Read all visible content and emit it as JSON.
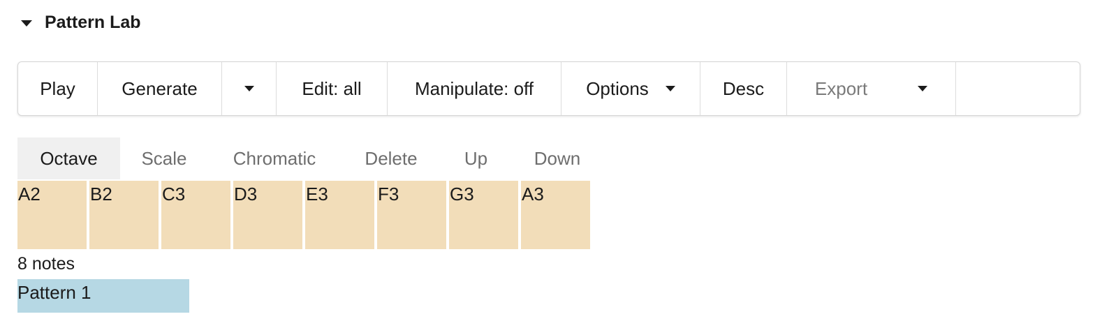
{
  "section": {
    "title": "Pattern Lab"
  },
  "toolbar": {
    "play": "Play",
    "generate": "Generate",
    "edit": "Edit: all",
    "manipulate": "Manipulate: off",
    "options": "Options",
    "desc": "Desc",
    "export": "Export"
  },
  "tabs": [
    {
      "label": "Octave",
      "active": true
    },
    {
      "label": "Scale",
      "active": false
    },
    {
      "label": "Chromatic",
      "active": false
    },
    {
      "label": "Delete",
      "active": false
    },
    {
      "label": "Up",
      "active": false
    },
    {
      "label": "Down",
      "active": false
    }
  ],
  "notes": [
    "A2",
    "B2",
    "C3",
    "D3",
    "E3",
    "F3",
    "G3",
    "A3"
  ],
  "note_count": "8 notes",
  "pattern": {
    "label": "Pattern 1"
  },
  "colors": {
    "note_bg": "#f2ddb9",
    "pattern_bg": "#b6d8e4",
    "active_tab_bg": "#f0f0f0"
  }
}
